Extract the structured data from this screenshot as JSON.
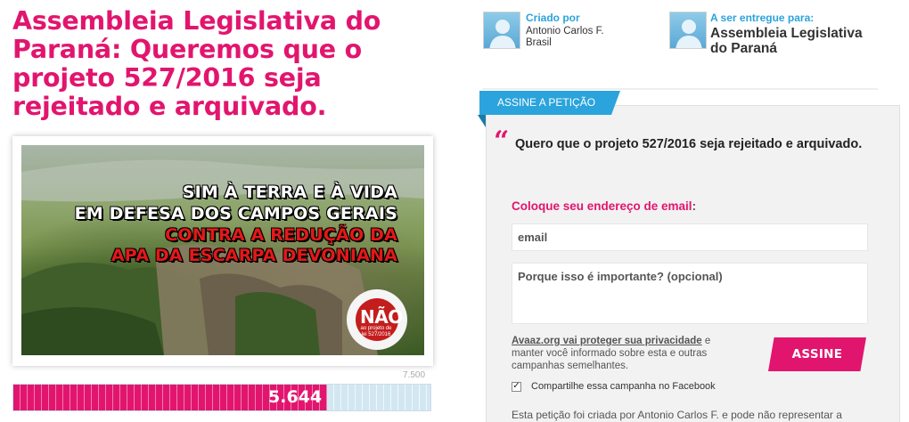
{
  "petition": {
    "title": "Assembleia Legislativa do Paraná: Queremos que o projeto 527/2016 seja rejeitado e arquivado."
  },
  "image_banner": {
    "line1": "SIM À TERRA E À VIDA",
    "line2": "EM DEFESA DOS CAMPOS GERAIS",
    "line3": "CONTRA A REDUÇÃO DA",
    "line4": "APA DA ESCARPA DEVONIANA",
    "seal_main": "NÃO",
    "seal_sub": "ao projeto de lei 527/2016",
    "seal_ring": "Pela manutenção da Área de Proteção Escarpa Devoniana"
  },
  "progress": {
    "count_label": "5.644",
    "goal_label": "7.500",
    "fraction": 0.7525
  },
  "creator": {
    "label": "Criado por",
    "name": "Antonio Carlos F. Brasil"
  },
  "recipient": {
    "label": "A ser entregue para:",
    "name": "Assembleia Legislativa do Paraná"
  },
  "form": {
    "tab_label": "ASSINE A PETIÇÃO",
    "quote": "Quero que o projeto 527/2016 seja rejeitado e arquivado.",
    "email_label": "Coloque seu endereço de email",
    "email_label_suffix": ":",
    "email_placeholder": "email",
    "reason_placeholder": "Porque isso é importante? (opcional)",
    "privacy_link": "Avaaz.org vai proteger sua privacidade",
    "privacy_text": " e manter você informado sobre esta e outras campanhas semelhantes.",
    "sign_button": "ASSINE",
    "facebook_label": "Compartilhe essa campanha no Facebook",
    "facebook_checked": "✓",
    "footnote": "Esta petição foi criada por Antonio Carlos F. e pode não representar a"
  },
  "colors": {
    "brand_pink": "#e2156e",
    "accent_blue": "#2ba3dc"
  },
  "icons": {
    "creator_avatar": "person-silhouette-icon",
    "recipient_avatar": "person-silhouette-icon",
    "quote": "open-quote-icon",
    "checkbox": "checkbox-checked-icon"
  }
}
